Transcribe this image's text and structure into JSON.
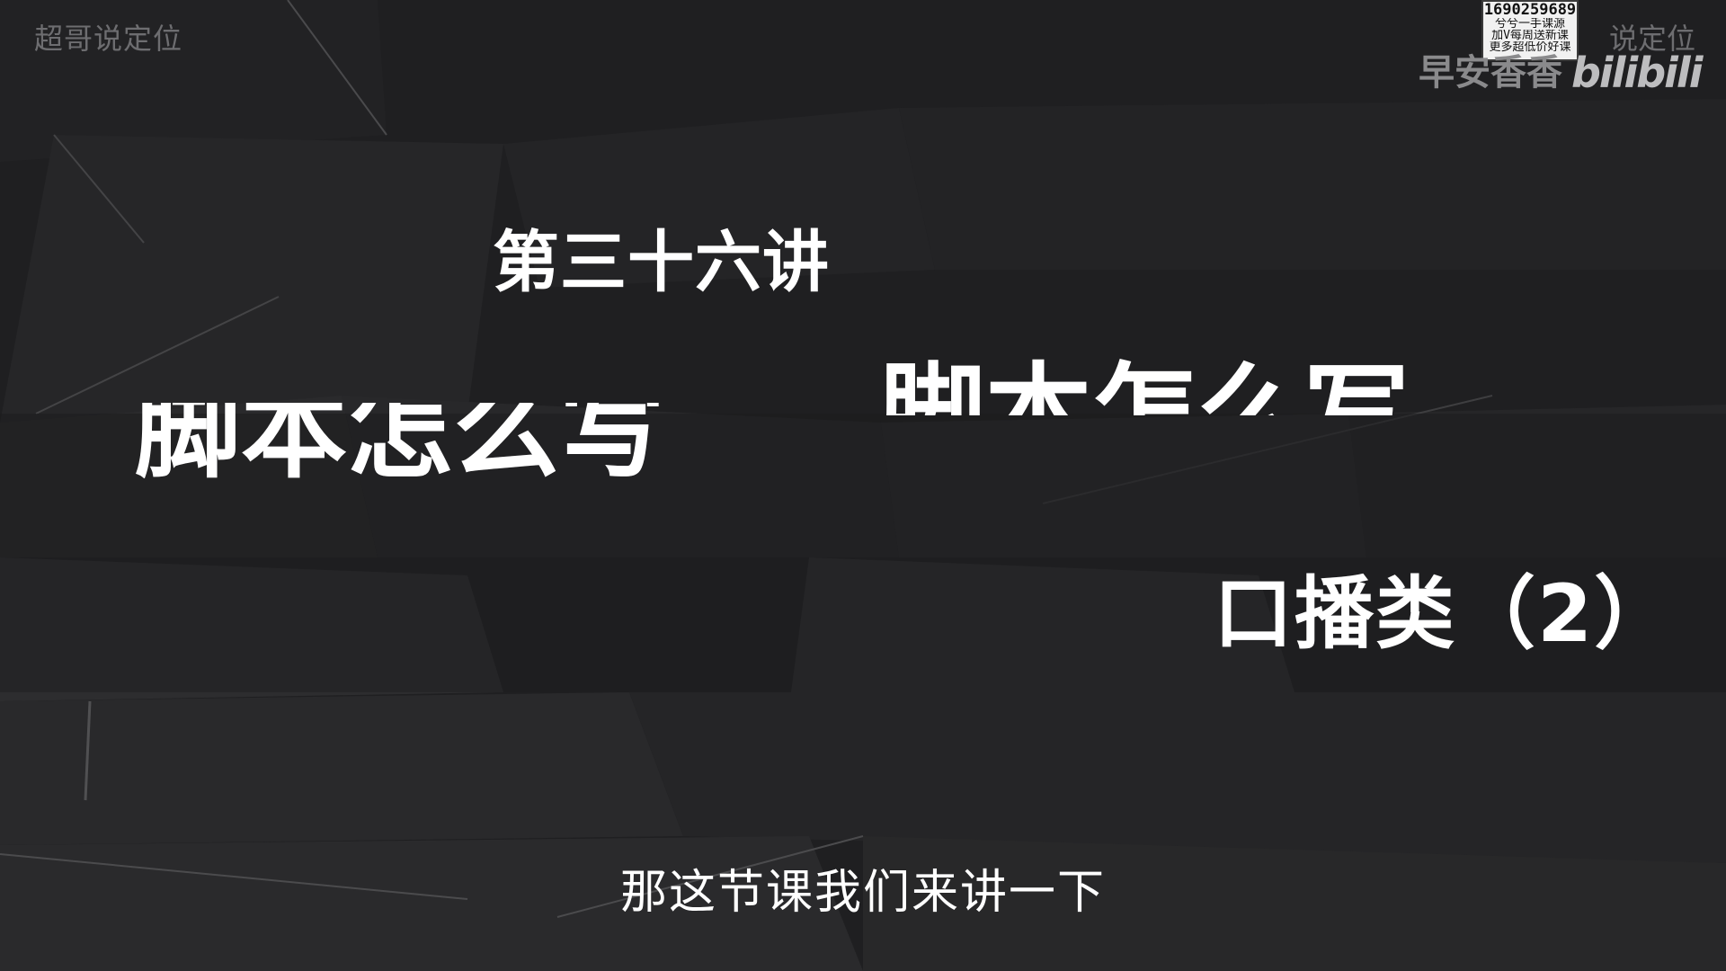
{
  "watermark": {
    "top_left": "超哥说定位",
    "top_right": "说定位"
  },
  "uploader": {
    "name": "早安香香",
    "platform_logo": "bilibili"
  },
  "promo": {
    "phone": "1690259689",
    "line1": "兮兮一手课源",
    "line2": "加V每周送新课",
    "line3": "更多超低价好课"
  },
  "slide": {
    "lecture_number": "第三十六讲",
    "title_left": "脚本怎么写",
    "title_right": "脚本怎么写",
    "category": "口播类（2）"
  },
  "caption": {
    "text": "那这节课我们来讲一下"
  },
  "colors": {
    "background": "#1f1f21",
    "text": "#ffffff",
    "watermark": "#6d6d70"
  }
}
